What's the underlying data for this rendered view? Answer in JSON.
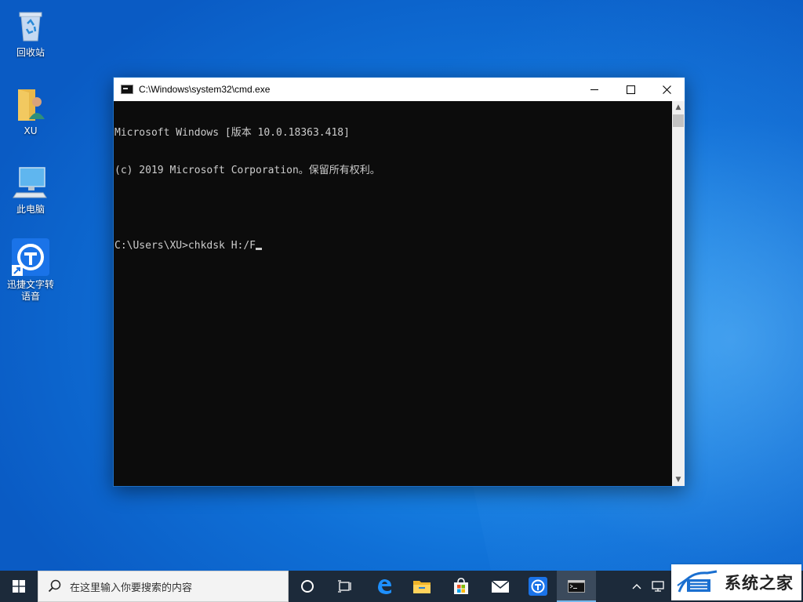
{
  "desktop": {
    "icons": [
      {
        "label": "回收站",
        "icon": "recycle-bin-icon"
      },
      {
        "label": "XU",
        "icon": "user-folder-icon"
      },
      {
        "label": "此电脑",
        "icon": "computer-icon"
      },
      {
        "label": "迅捷文字转语音",
        "icon": "app-shortcut-icon"
      }
    ]
  },
  "window": {
    "title": "C:\\Windows\\system32\\cmd.exe",
    "console_lines": [
      "Microsoft Windows [版本 10.0.18363.418]",
      "(c) 2019 Microsoft Corporation。保留所有权利。",
      "",
      "C:\\Users\\XU>chkdsk H:/F"
    ],
    "colors": {
      "console_bg": "#0c0c0c",
      "console_fg": "#cccccc"
    }
  },
  "taskbar": {
    "search_placeholder": "在这里输入你要搜索的内容",
    "apps": [
      "task-view-icon",
      "edge-icon",
      "file-explorer-icon",
      "store-icon",
      "mail-icon",
      "xunjie-app-icon",
      "cmd-icon"
    ]
  },
  "watermark": {
    "text": "系统之家"
  }
}
